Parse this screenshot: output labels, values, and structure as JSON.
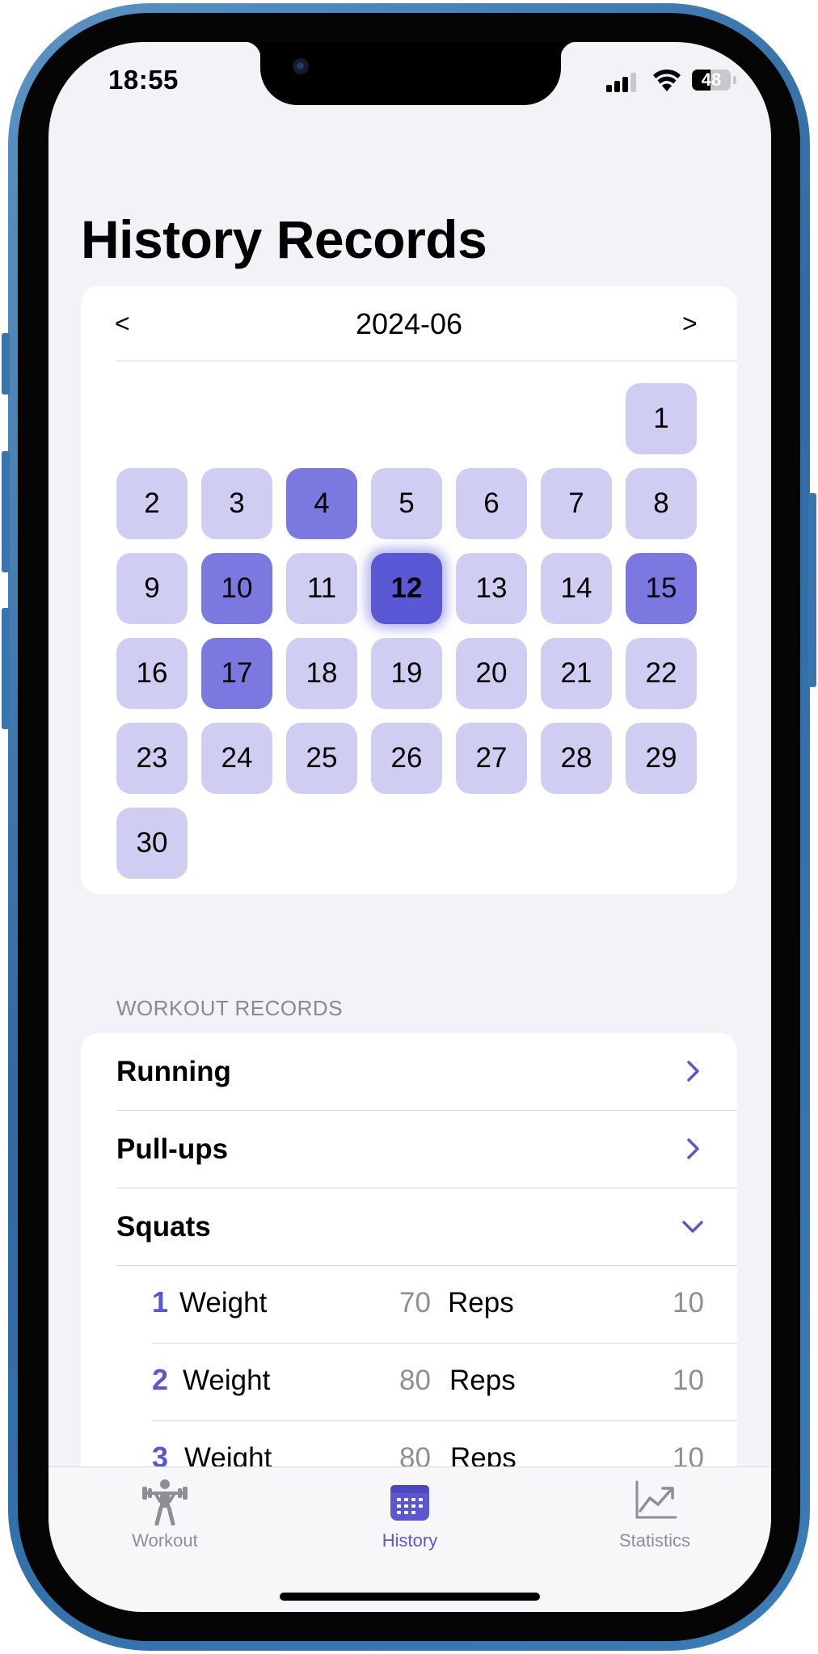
{
  "status_bar": {
    "time": "18:55",
    "battery": "48",
    "battery_level": 0.48
  },
  "page": {
    "title": "History Records"
  },
  "calendar": {
    "prev_label": "<",
    "next_label": ">",
    "month": "2024-06",
    "first_weekday_index": 6,
    "days": [
      {
        "label": "1",
        "state": "normal"
      },
      {
        "label": "2",
        "state": "normal"
      },
      {
        "label": "3",
        "state": "normal"
      },
      {
        "label": "4",
        "state": "recorded"
      },
      {
        "label": "5",
        "state": "normal"
      },
      {
        "label": "6",
        "state": "normal"
      },
      {
        "label": "7",
        "state": "normal"
      },
      {
        "label": "8",
        "state": "normal"
      },
      {
        "label": "9",
        "state": "normal"
      },
      {
        "label": "10",
        "state": "recorded"
      },
      {
        "label": "11",
        "state": "normal"
      },
      {
        "label": "12",
        "state": "selected"
      },
      {
        "label": "13",
        "state": "normal"
      },
      {
        "label": "14",
        "state": "normal"
      },
      {
        "label": "15",
        "state": "recorded"
      },
      {
        "label": "16",
        "state": "normal"
      },
      {
        "label": "17",
        "state": "recorded"
      },
      {
        "label": "18",
        "state": "normal"
      },
      {
        "label": "19",
        "state": "normal"
      },
      {
        "label": "20",
        "state": "normal"
      },
      {
        "label": "21",
        "state": "normal"
      },
      {
        "label": "22",
        "state": "normal"
      },
      {
        "label": "23",
        "state": "normal"
      },
      {
        "label": "24",
        "state": "normal"
      },
      {
        "label": "25",
        "state": "normal"
      },
      {
        "label": "26",
        "state": "normal"
      },
      {
        "label": "27",
        "state": "normal"
      },
      {
        "label": "28",
        "state": "normal"
      },
      {
        "label": "29",
        "state": "normal"
      },
      {
        "label": "30",
        "state": "normal"
      }
    ]
  },
  "records": {
    "section_title": "WORKOUT RECORDS",
    "items": [
      {
        "label": "Running",
        "icon": "chevron-right-icon"
      },
      {
        "label": "Pull-ups",
        "icon": "chevron-right-icon"
      },
      {
        "label": "Squats",
        "icon": "chevron-down-icon"
      }
    ],
    "sets": [
      {
        "num": "1",
        "weight_label": "Weight",
        "weight": "70",
        "reps_label": "Reps",
        "reps": "10"
      },
      {
        "num": "2",
        "weight_label": "Weight",
        "weight": "80",
        "reps_label": "Reps",
        "reps": "10"
      },
      {
        "num": "3",
        "weight_label": "Weight",
        "weight": "80",
        "reps_label": "Reps",
        "reps": "10"
      }
    ]
  },
  "tabs": [
    {
      "label": "Workout",
      "icon": "weightlifter-icon",
      "active": false
    },
    {
      "label": "History",
      "icon": "calendar-icon",
      "active": true
    },
    {
      "label": "Statistics",
      "icon": "line-chart-icon",
      "active": false
    }
  ],
  "colors": {
    "accent": "#5a57d0",
    "day_normal": "#cfcdf1",
    "day_recorded": "#7b78df",
    "day_selected": "#5b58d6",
    "background": "#f2f2f7"
  }
}
